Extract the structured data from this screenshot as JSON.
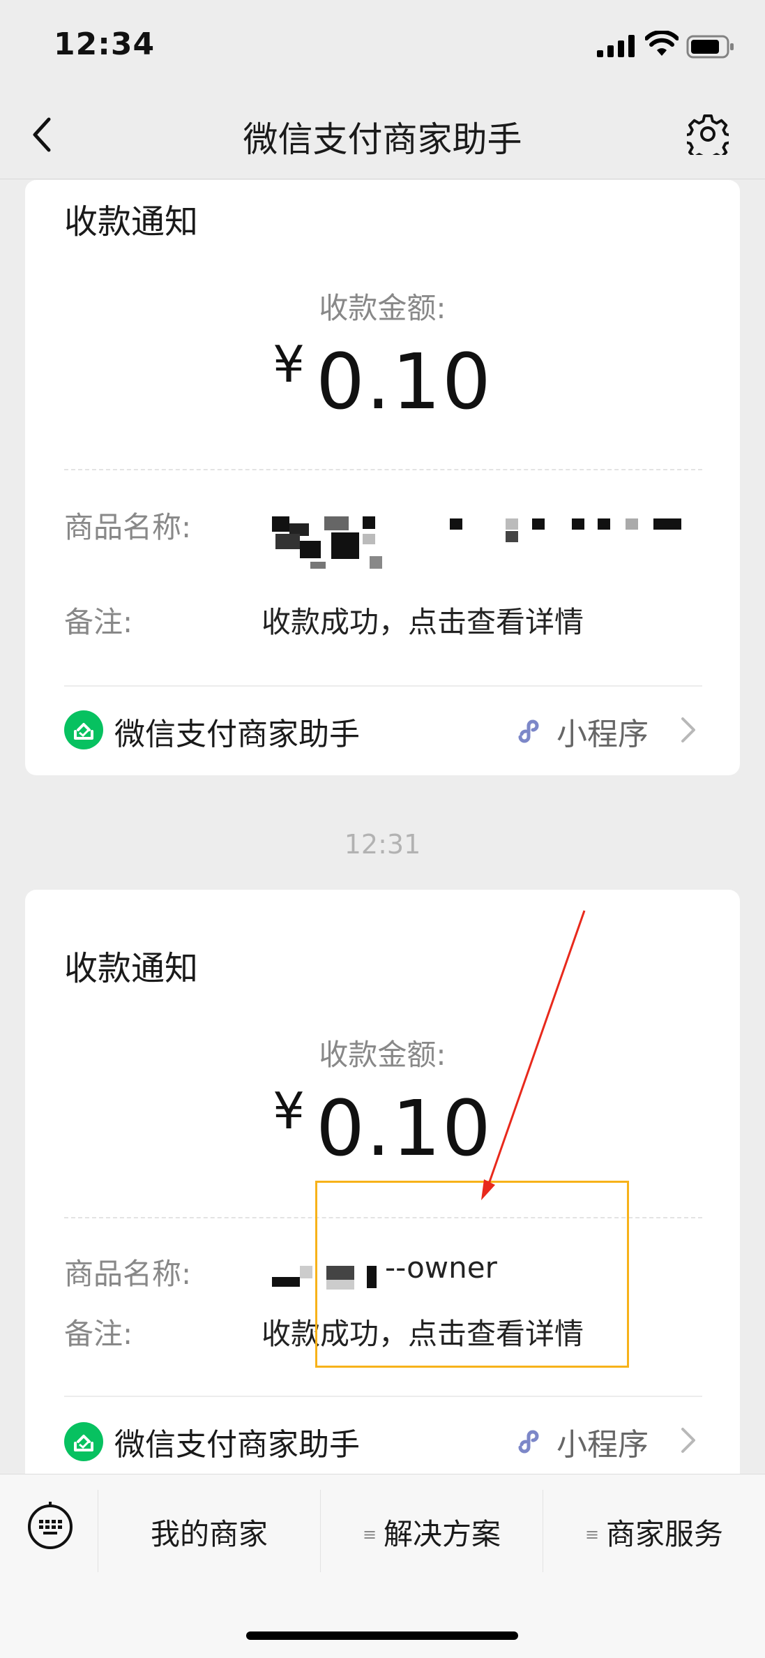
{
  "status_bar": {
    "time": "12:34"
  },
  "nav": {
    "title": "微信支付商家助手"
  },
  "messages": [
    {
      "title": "收款通知",
      "amount_label": "收款金额:",
      "currency": "¥",
      "amount": "0.10",
      "product_label": "商品名称:",
      "product_value": "",
      "remark_label": "备注:",
      "remark_value": "收款成功，点击查看详情",
      "app_name": "微信支付商家助手",
      "mini_program": "小程序"
    },
    {
      "time": "12:31",
      "title": "收款通知",
      "amount_label": "收款金额:",
      "currency": "¥",
      "amount": "0.10",
      "product_label": "商品名称:",
      "product_value": "--owner",
      "remark_label": "备注:",
      "remark_value": "收款成功，点击查看详情",
      "app_name": "微信支付商家助手",
      "mini_program": "小程序"
    }
  ],
  "bottom_menu": {
    "items": [
      {
        "label": "我的商家"
      },
      {
        "label": "解决方案"
      },
      {
        "label": "商家服务"
      }
    ]
  },
  "colors": {
    "accent": "#07c160",
    "highlight": "#f7b21a",
    "arrow": "#e8291c"
  }
}
